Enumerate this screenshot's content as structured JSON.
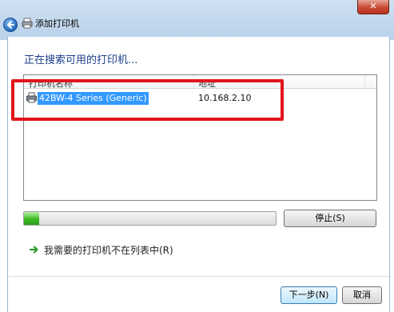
{
  "window": {
    "title": "添加打印机",
    "close_glyph": "✕"
  },
  "heading": "正在搜索可用的打印机...",
  "printer_list": {
    "columns": [
      "打印机名称",
      "地址"
    ],
    "rows": [
      {
        "name": "42BW-4 Series (Generic)",
        "address": "10.168.2.10",
        "icon": "printer-icon",
        "selected": true
      }
    ]
  },
  "search_progress": 0.06,
  "buttons": {
    "stop": "停止(S)",
    "next": "下一步(N)",
    "cancel": "取消"
  },
  "link": {
    "text": "我需要的打印机不在列表中(R)",
    "icon": "green-arrow-icon"
  },
  "colors": {
    "heading": "#1e3f8b",
    "selection": "#3399ff",
    "highlight_box": "#e0151b",
    "progress": "#3dbb23"
  }
}
